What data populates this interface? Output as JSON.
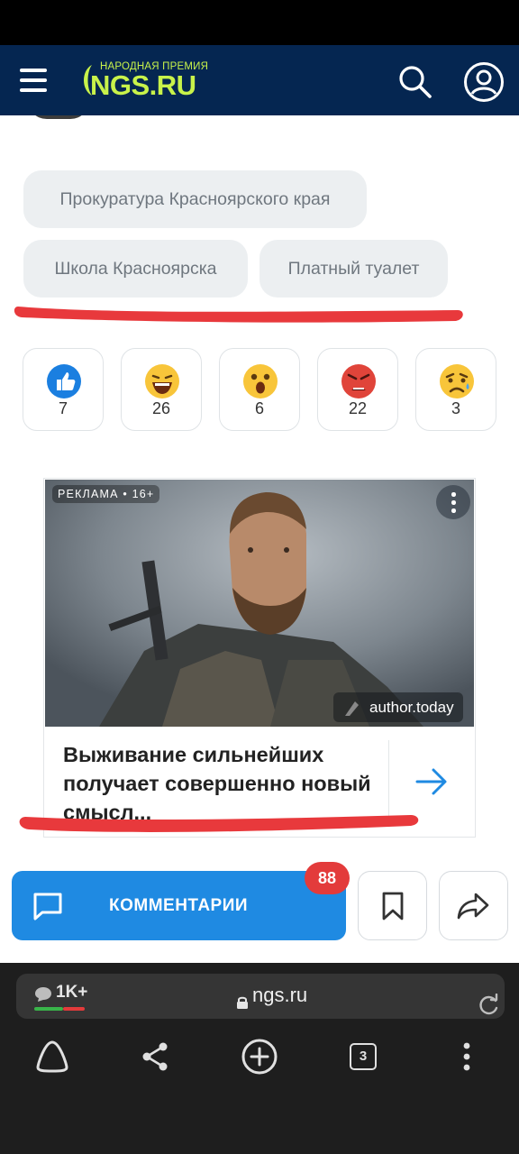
{
  "header": {
    "logo_award": "НАРОДНАЯ ПРЕМИЯ",
    "logo_text": "NGS.RU",
    "icons": [
      "menu-icon",
      "search-icon",
      "user-icon"
    ],
    "colors": {
      "header_bg": "#052651",
      "logo": "#c8f24a"
    }
  },
  "tags": [
    "Прокуратура Красноярского края",
    "Школа Красноярска",
    "Платный туалет"
  ],
  "reactions": [
    {
      "icon": "like-emoji-icon",
      "count": "7"
    },
    {
      "icon": "laughing-emoji-icon",
      "count": "26"
    },
    {
      "icon": "surprised-emoji-icon",
      "count": "6"
    },
    {
      "icon": "angry-emoji-icon",
      "count": "22"
    },
    {
      "icon": "sad-emoji-icon",
      "count": "3"
    }
  ],
  "ad": {
    "label": "РЕКЛАМА • 16+",
    "source": "author.today",
    "title": "Выживание сильнейших получает совершенно новый смысл..."
  },
  "actions": {
    "comments_label": "КОММЕНТАРИИ",
    "comments_badge": "88",
    "colors": {
      "comments_button": "#1f8ae2",
      "badge": "#e33b3b"
    }
  },
  "browser": {
    "comment_count": "1K+",
    "url": "ngs.ru",
    "tab_count": "3"
  }
}
